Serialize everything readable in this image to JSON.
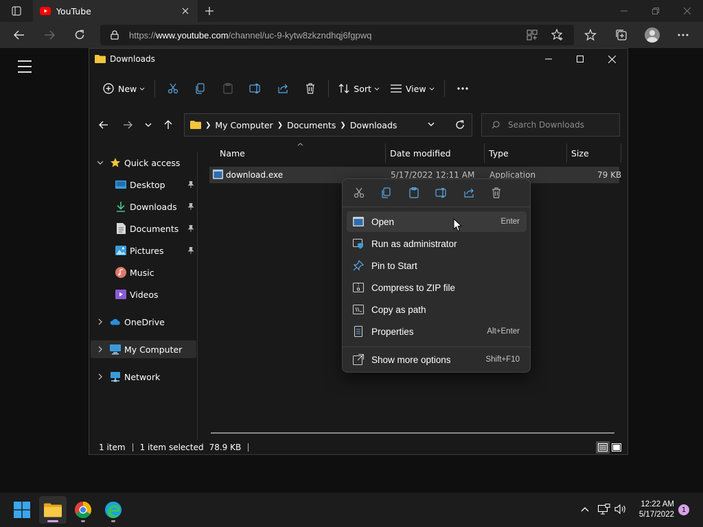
{
  "browser": {
    "tab_title": "YouTube",
    "url_prefix": "https://",
    "url_host": "www.youtube.com",
    "url_path": "/channel/uc-9-kytw8zkzndhqj6fgpwq"
  },
  "explorer": {
    "title": "Downloads",
    "toolbar": {
      "new_label": "New",
      "sort_label": "Sort",
      "view_label": "View"
    },
    "breadcrumb": [
      "My Computer",
      "Documents",
      "Downloads"
    ],
    "search_placeholder": "Search Downloads",
    "sidebar": {
      "quick_access": "Quick access",
      "desktop": "Desktop",
      "downloads": "Downloads",
      "documents": "Documents",
      "pictures": "Pictures",
      "music": "Music",
      "videos": "Videos",
      "onedrive": "OneDrive",
      "my_computer": "My Computer",
      "network": "Network"
    },
    "columns": {
      "name": "Name",
      "date": "Date modified",
      "type": "Type",
      "size": "Size"
    },
    "file": {
      "name": "download.exe",
      "date": "5/17/2022 12:11 AM",
      "type": "Application",
      "size": "79 KB"
    },
    "status": {
      "count": "1 item",
      "selected": "1 item selected",
      "size": "78.9 KB"
    }
  },
  "context_menu": {
    "open": "Open",
    "open_key": "Enter",
    "run_admin": "Run as administrator",
    "pin_start": "Pin to Start",
    "compress": "Compress to ZIP file",
    "copy_path": "Copy as path",
    "properties": "Properties",
    "properties_key": "Alt+Enter",
    "more_options": "Show more options",
    "more_options_key": "Shift+F10"
  },
  "taskbar": {
    "time": "12:22 AM",
    "date": "5/17/2022",
    "notifications": "1"
  },
  "colors": {
    "accent_blue": "#3a9bdc",
    "folder_yellow": "#f2c53d",
    "youtube_red": "#ff0000"
  }
}
